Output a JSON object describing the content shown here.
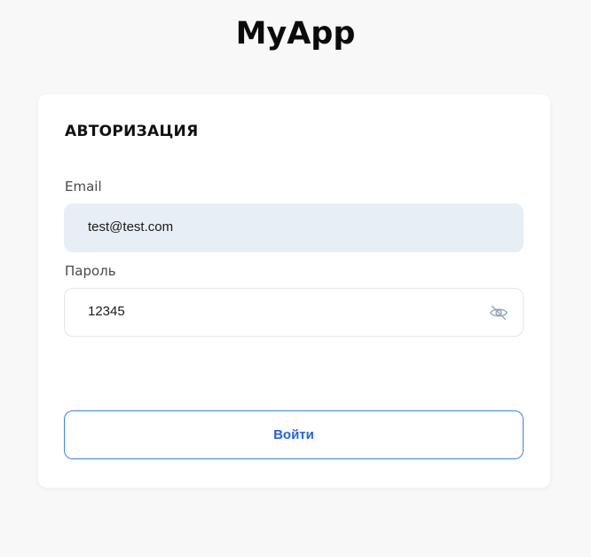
{
  "app": {
    "title": "MyApp"
  },
  "login_form": {
    "title": "АВТОРИЗАЦИЯ",
    "email": {
      "label": "Email",
      "value": "test@test.com"
    },
    "password": {
      "label": "Пароль",
      "value": "12345",
      "toggle_icon": "eye-off-icon"
    },
    "submit_label": "Войти"
  },
  "colors": {
    "page_background": "#f8f8f8",
    "card_background": "#ffffff",
    "email_input_background": "#e8eef5",
    "accent": "#2563eb"
  }
}
